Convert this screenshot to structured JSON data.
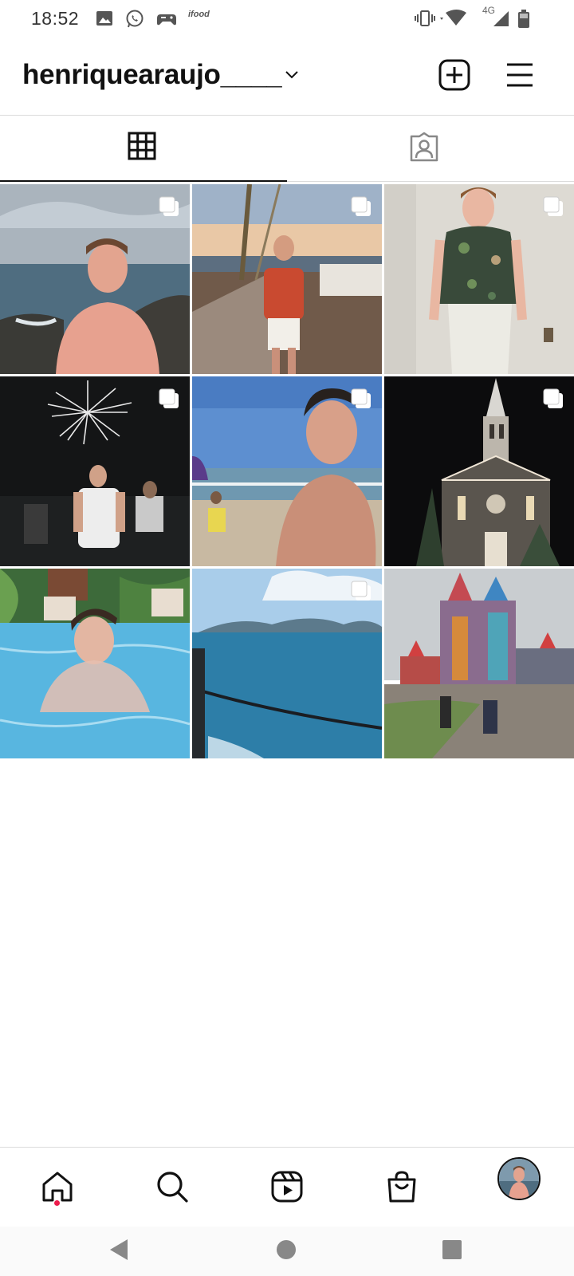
{
  "status_bar": {
    "time": "18:52",
    "notification_icons": [
      "image-icon",
      "whatsapp-icon",
      "game-controller-icon",
      "ifood-icon"
    ],
    "ifood_label": "ifood",
    "network_label": "4G",
    "system_icons": [
      "vibrate-icon",
      "wifi-icon",
      "signal-icon",
      "battery-icon"
    ]
  },
  "header": {
    "username": "henriquearaujo____",
    "account_switcher_icon": "chevron-down-icon",
    "new_post_icon": "plus-square-icon",
    "menu_icon": "hamburger-menu-icon"
  },
  "tabs": [
    {
      "name": "posts-grid",
      "icon": "grid-icon",
      "active": true
    },
    {
      "name": "tagged",
      "icon": "tagged-person-icon",
      "active": false
    }
  ],
  "posts": [
    {
      "subject": "shirtless man at rocky seaside, cloudy sky",
      "multiple": true
    },
    {
      "subject": "man in red shirt on boardwalk at sunset",
      "multiple": true
    },
    {
      "subject": "man in floral shirt against white wall",
      "multiple": true
    },
    {
      "subject": "man in white t-shirt under fireworks at night",
      "multiple": true
    },
    {
      "subject": "shirtless man on sunny beach",
      "multiple": true
    },
    {
      "subject": "illuminated church at night",
      "multiple": true
    },
    {
      "subject": "man in swimming pool",
      "multiple": false
    },
    {
      "subject": "blue sea view from boat",
      "multiple": true
    },
    {
      "subject": "colorful castle theme park",
      "multiple": false
    }
  ],
  "bottom_nav": [
    {
      "name": "home",
      "icon": "home-icon",
      "has_notification": true
    },
    {
      "name": "search",
      "icon": "search-icon"
    },
    {
      "name": "reels",
      "icon": "reels-icon"
    },
    {
      "name": "shop",
      "icon": "shopping-bag-icon"
    },
    {
      "name": "profile",
      "icon": "profile-avatar"
    }
  ],
  "system_nav": [
    "back-icon",
    "home-circle-icon",
    "recents-icon"
  ],
  "colors": {
    "text": "#111111",
    "divider": "#dbdbdb",
    "notification_dot": "#ed1c4c",
    "background": "#ffffff"
  }
}
